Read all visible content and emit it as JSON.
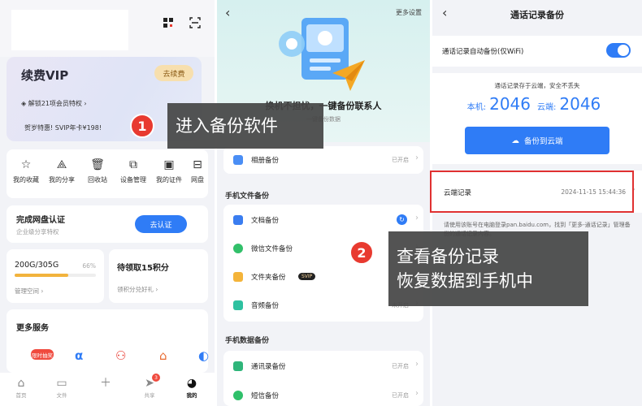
{
  "p1": {
    "vip_title": "续费VIP",
    "renew_label": "去续费",
    "vip_line1": "解锁21项会员特权",
    "vip_line2": "贺岁特惠! SVIP年卡¥198!",
    "tools": [
      "我的收藏",
      "我的分享",
      "回收站",
      "设备管理",
      "我的证件",
      "网盘"
    ],
    "verify_title": "完成网盘认证",
    "verify_sub": "企业级分享特权",
    "verify_btn": "去认证",
    "storage_value": "200G/305G",
    "storage_pct": "66%",
    "storage_fraction": 0.66,
    "storage_link": "管理空间 ›",
    "points_title": "待领取15积分",
    "points_sub": "领积分兑好礼 ›",
    "services_title": "更多服务",
    "services_badge": "限时抽奖",
    "tabs": [
      "首页",
      "文件",
      "",
      "共享",
      "我的"
    ],
    "tab_dot": "3"
  },
  "p2": {
    "more": "更多设置",
    "hero_title": "换机不担忧，一键备份联系人",
    "hero_sub": "一键备份数据",
    "album_label": "相册备份",
    "album_state": "已开启",
    "sec1": "手机文件备份",
    "doc_label": "文档备份",
    "wechat_label": "微信文件备份",
    "folder_label": "文件夹备份",
    "svip": "SVIP",
    "audio_label": "音频备份",
    "audio_state": "未开启",
    "sec2": "手机数据备份",
    "contacts_label": "通讯录备份",
    "contacts_state": "已开启",
    "sms_label": "短信备份",
    "sms_state": "已开启"
  },
  "p3": {
    "title": "通话记录备份",
    "auto_label": "通话记录自动备份(仅WiFi)",
    "stat_note": "通话记录存于云端，安全不丢失",
    "local_label": "本机:",
    "local_value": "2046",
    "cloud_label": "云端:",
    "cloud_value": "2046",
    "cloud_btn": "备份到云端",
    "record_label": "云端记录",
    "record_time": "2024-11-15  15:44:36",
    "tip": "请使用该账号在电脑登录pan.baidu.com，找到「更多-通话记录」管理备份的通话记录内容。"
  },
  "callouts": {
    "c1_num": "1",
    "c1_text": "进入备份软件",
    "c2_num": "2",
    "c2_line1": "查看备份记录",
    "c2_line2": "恢复数据到手机中"
  },
  "colors": {
    "accent": "#2f7cf6",
    "badge": "#e83a30",
    "highlight": "#e03131"
  }
}
